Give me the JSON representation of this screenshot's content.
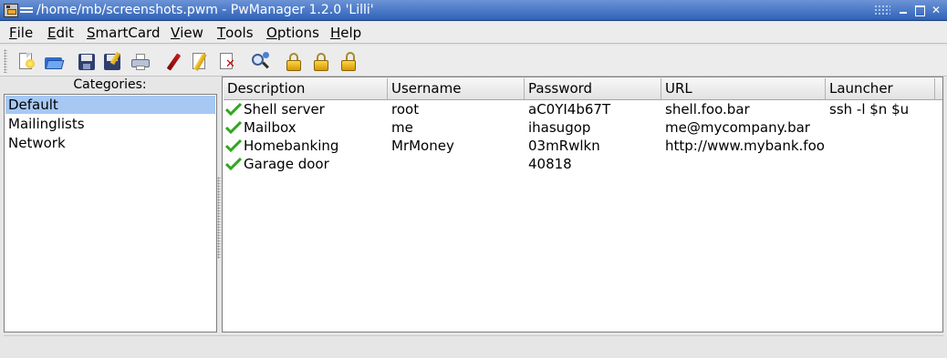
{
  "window": {
    "title": "/home/mb/screenshots.pwm - PwManager 1.2.0 'Lilli'"
  },
  "menu": [
    {
      "accel": "F",
      "rest": "ile"
    },
    {
      "accel": "E",
      "rest": "dit"
    },
    {
      "accel": "S",
      "rest": "martCard"
    },
    {
      "accel": "V",
      "rest": "iew"
    },
    {
      "accel": "T",
      "rest": "ools"
    },
    {
      "accel": "O",
      "rest": "ptions"
    },
    {
      "accel": "H",
      "rest": "elp"
    }
  ],
  "toolbar": {
    "icons": [
      "new-document-icon",
      "open-folder-icon",
      "save-icon",
      "save-as-icon",
      "print-icon",
      "add-entry-pen-icon",
      "edit-entry-pencil-icon",
      "delete-entry-icon",
      "find-icon",
      "lock-icon",
      "lock-all-icon",
      "unlock-icon"
    ]
  },
  "categories": {
    "label": "Categories:",
    "items": [
      "Default",
      "Mailinglists",
      "Network"
    ],
    "selected": "Default"
  },
  "entries": {
    "columns": [
      "Description",
      "Username",
      "Password",
      "URL",
      "Launcher"
    ],
    "rows": [
      {
        "description": "Shell server",
        "username": "root",
        "password": "aC0YI4b67T",
        "url": "shell.foo.bar",
        "launcher": "ssh -l $n $u"
      },
      {
        "description": "Mailbox",
        "username": "me",
        "password": "ihasugop",
        "url": "me@mycompany.bar",
        "launcher": ""
      },
      {
        "description": "Homebanking",
        "username": "MrMoney",
        "password": "03mRwlkn",
        "url": "http://www.mybank.foo",
        "launcher": ""
      },
      {
        "description": "Garage door",
        "username": "",
        "password": "40818",
        "url": "",
        "launcher": ""
      }
    ],
    "check_color": "#2fa81f"
  },
  "colors": {
    "titlebar": "#3d6cc0",
    "selection": "#a6c8f3",
    "window_bg": "#e6e6e6"
  }
}
